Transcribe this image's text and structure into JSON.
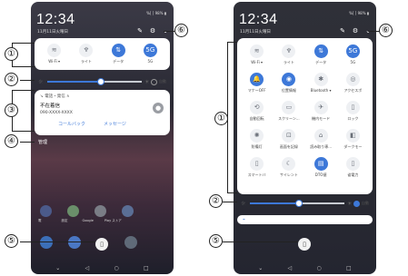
{
  "phone1": {
    "status_left": "ddd",
    "status_right": "%[ ] 98% ▮",
    "clock": "12:34",
    "date": "11月11日火曜日",
    "qs_icons": [
      "✎",
      "⚙",
      "⌄"
    ],
    "tiles": [
      {
        "label": "Wi-Fi ▾",
        "icon": "wifi-icon",
        "glyph": "≋",
        "on": false
      },
      {
        "label": "ライト",
        "icon": "flashlight-icon",
        "glyph": "♆",
        "on": false
      },
      {
        "label": "データ",
        "icon": "data-icon",
        "glyph": "⇅",
        "on": true
      },
      {
        "label": "5G",
        "icon": "5g-icon",
        "glyph": "5G",
        "on": true
      }
    ],
    "brightness": {
      "level": 0.57,
      "auto_label": "自動",
      "auto_on": false
    },
    "notification": {
      "app": "↘ 電話・発信 ∧",
      "title": "不在着信",
      "number": "090-XXXX-XXXX",
      "callback": "コールバック",
      "message": "メッセージ"
    },
    "manage_label": "管理",
    "app_labels": [
      "電",
      "設定",
      "Google",
      "Play ストア"
    ]
  },
  "phone2": {
    "clock": "12:34",
    "date": "11月11日火曜日",
    "qs_icons": [
      "✎",
      "⚙",
      "⌄"
    ],
    "tiles": [
      {
        "label": "Wi-Fi ▾",
        "glyph": "≋",
        "on": false
      },
      {
        "label": "ライト",
        "glyph": "♆",
        "on": false
      },
      {
        "label": "データ",
        "glyph": "⇅",
        "on": true
      },
      {
        "label": "5G",
        "glyph": "5G",
        "on": true
      },
      {
        "label": "マナーOFF",
        "glyph": "🔔",
        "on": true
      },
      {
        "label": "位置情報",
        "glyph": "◉",
        "on": true
      },
      {
        "label": "Bluetooth ▾",
        "glyph": "✱",
        "on": false
      },
      {
        "label": "アクセスポ",
        "glyph": "◎",
        "on": false
      },
      {
        "label": "自動回転",
        "glyph": "⟲",
        "on": false
      },
      {
        "label": "スクリーン...",
        "glyph": "▭",
        "on": false
      },
      {
        "label": "機内モード",
        "glyph": "✈",
        "on": false
      },
      {
        "label": "ロック",
        "glyph": "▯",
        "on": false
      },
      {
        "label": "防備灯",
        "glyph": "✺",
        "on": false
      },
      {
        "label": "画面を記録",
        "glyph": "⊡",
        "on": false
      },
      {
        "label": "読み取り専...",
        "glyph": "⌂",
        "on": false
      },
      {
        "label": "ダークモー",
        "glyph": "◧",
        "on": false
      },
      {
        "label": "スマートバ",
        "glyph": "▯",
        "on": false
      },
      {
        "label": "サイレント",
        "glyph": "☾",
        "on": false
      },
      {
        "label": "DTO値",
        "glyph": "▤",
        "on": true
      },
      {
        "label": "省電力",
        "glyph": "▯",
        "on": false
      }
    ],
    "brightness": {
      "level": 0.52,
      "auto_label": "自動",
      "auto_on": true
    },
    "media_label": "⌁"
  },
  "nav": [
    "⌄",
    "◁",
    "○",
    "□"
  ],
  "callouts": [
    "①",
    "②",
    "③",
    "④",
    "⑤",
    "⑥"
  ]
}
